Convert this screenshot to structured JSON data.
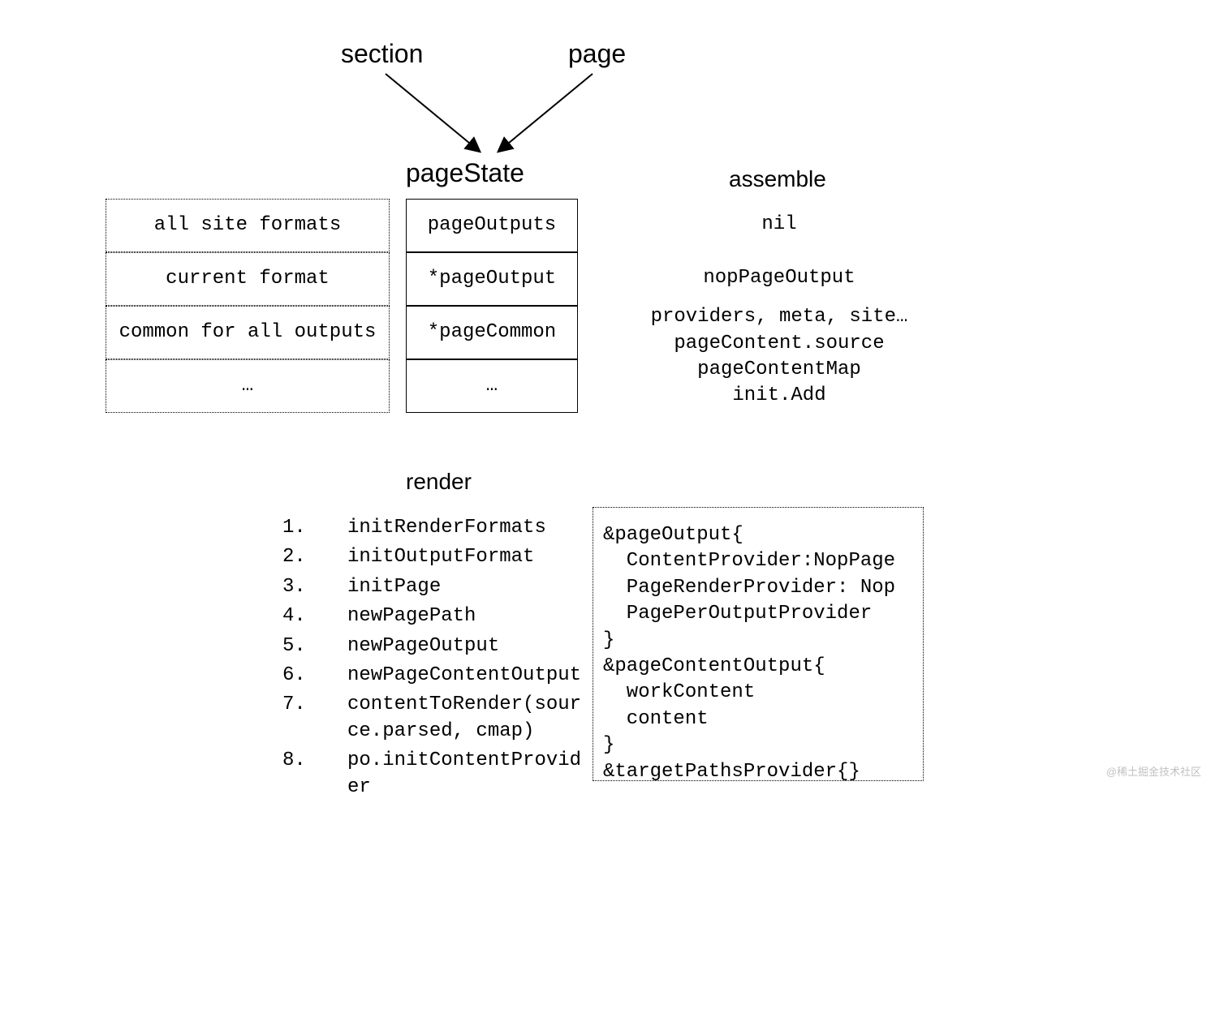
{
  "top": {
    "section": "section",
    "page": "page"
  },
  "titles": {
    "pageState": "pageState",
    "assemble": "assemble",
    "render": "render"
  },
  "rows": [
    {
      "left": "all site formats",
      "mid": "pageOutputs",
      "right": "nil"
    },
    {
      "left": "current format",
      "mid": "*pageOutput",
      "right": "nopPageOutput"
    },
    {
      "left": "common for all outputs",
      "mid": "*pageCommon",
      "right": "providers, meta, site…\npageContent.source\npageContentMap\ninit.Add"
    },
    {
      "left": "…",
      "mid": "…",
      "right": ""
    }
  ],
  "render_steps": [
    {
      "n": "1.",
      "t": "initRenderFormats"
    },
    {
      "n": "2.",
      "t": "initOutputFormat"
    },
    {
      "n": "3.",
      "t": "initPage"
    },
    {
      "n": "4.",
      "t": "newPagePath"
    },
    {
      "n": "5.",
      "t": "newPageOutput"
    },
    {
      "n": "6.",
      "t": "newPageContentOutput"
    },
    {
      "n": "7.",
      "t": "contentToRender(source.parsed, cmap)"
    },
    {
      "n": "8.",
      "t": "po.initContentProvider"
    }
  ],
  "struct_code": "&pageOutput{\n  ContentProvider:NopPage\n  PageRenderProvider: Nop\n  PagePerOutputProvider\n}\n&pageContentOutput{\n  workContent\n  content\n}\n&targetPathsProvider{}",
  "watermark": "@稀土掘金技术社区"
}
